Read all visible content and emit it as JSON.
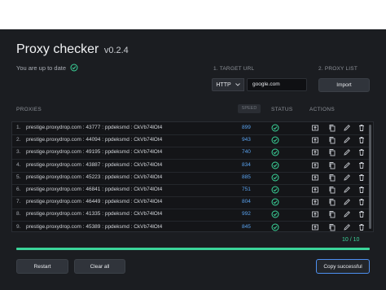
{
  "app": {
    "title": "Proxy checker",
    "version": "v0.2.4",
    "status_text": "You are up to date",
    "accent_color": "#3bd49a",
    "link_color": "#5aa3f0"
  },
  "target": {
    "label": "1. TARGET URL",
    "protocol": "HTTP",
    "url_value": "google.com"
  },
  "proxy_list": {
    "label": "2. PROXY LIST",
    "import_label": "Import"
  },
  "table": {
    "col_proxies": "PROXIES",
    "col_speed": "SPEED",
    "col_status": "STATUS",
    "col_actions": "ACTIONS",
    "rows": [
      {
        "num": "1.",
        "proxy": "prestige.proxydrop.com : 43777 : ppdeksmd : CkVb74lOt4",
        "speed": "899"
      },
      {
        "num": "2.",
        "proxy": "prestige.proxydrop.com : 44094 : ppdeksmd : CkVb74lOt4",
        "speed": "943"
      },
      {
        "num": "3.",
        "proxy": "prestige.proxydrop.com : 49195 : ppdeksmd : CkVb74lOt4",
        "speed": "740"
      },
      {
        "num": "4.",
        "proxy": "prestige.proxydrop.com : 43887 : ppdeksmd : CkVb74lOt4",
        "speed": "834"
      },
      {
        "num": "5.",
        "proxy": "prestige.proxydrop.com : 45223 : ppdeksmd : CkVb74lOt4",
        "speed": "885"
      },
      {
        "num": "6.",
        "proxy": "prestige.proxydrop.com : 46841 : ppdeksmd : CkVb74lOt4",
        "speed": "751"
      },
      {
        "num": "7.",
        "proxy": "prestige.proxydrop.com : 46449 : ppdeksmd : CkVb74lOt4",
        "speed": "804"
      },
      {
        "num": "8.",
        "proxy": "prestige.proxydrop.com : 41335 : ppdeksmd : CkVb74lOt4",
        "speed": "992"
      },
      {
        "num": "9.",
        "proxy": "prestige.proxydrop.com : 45389 : ppdeksmd : CkVb74lOt4",
        "speed": "845"
      }
    ]
  },
  "progress": {
    "text": "10 / 10",
    "fraction": 1.0
  },
  "buttons": {
    "restart": "Restart",
    "clear_all": "Clear all",
    "copy": "Copy successful"
  },
  "icons": [
    "check-circle-icon",
    "export-icon",
    "copy-icon",
    "edit-icon",
    "trash-icon",
    "chevron-down-icon"
  ]
}
